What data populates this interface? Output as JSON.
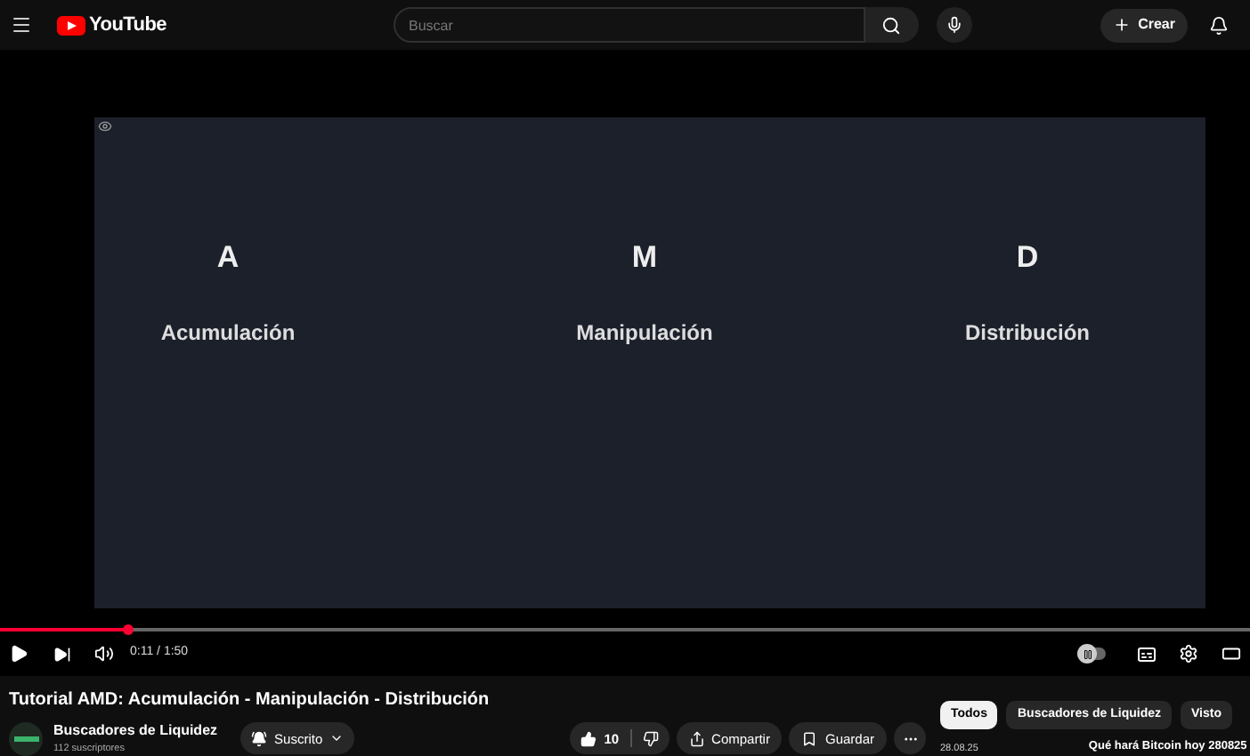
{
  "header": {
    "logo": "YouTube",
    "search": {
      "placeholder": "Buscar"
    },
    "create_button": "Crear"
  },
  "slide": {
    "columns": [
      {
        "letter": "A",
        "label": "Acumulación"
      },
      {
        "letter": "M",
        "label": "Manipulación"
      },
      {
        "letter": "D",
        "label": "Distribución"
      }
    ]
  },
  "player": {
    "progress": {
      "level": 0.103
    },
    "time": "0:11 / 1:50",
    "autoplay": {
      "on": false
    }
  },
  "video": {
    "title": "Tutorial AMD: Acumulación - Manipulación - Distribución",
    "channel": {
      "name": "Buscadores de Liquidez",
      "subscribers": "112 suscriptores"
    },
    "subscribe_button": "Suscrito",
    "likes": "10",
    "share_button": "Compartir",
    "save_button": "Guardar"
  },
  "filters": [
    {
      "label": "Todos",
      "selected": true
    },
    {
      "label": "Buscadores de Liquidez",
      "selected": false
    },
    {
      "label": "Visto",
      "selected": false
    }
  ],
  "recommendation": {
    "date": "28.08.25",
    "title": "Qué hará Bitcoin hoy 280825"
  }
}
